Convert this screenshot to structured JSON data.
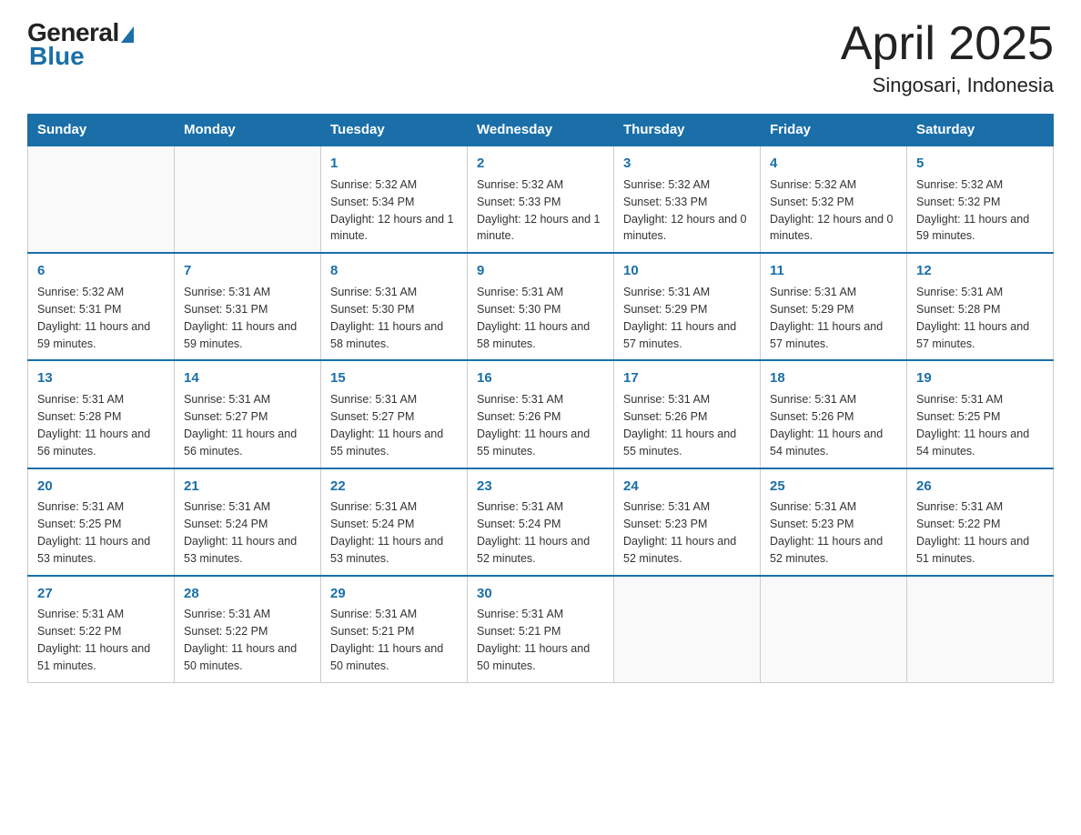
{
  "logo": {
    "general": "General",
    "blue": "Blue"
  },
  "title": "April 2025",
  "subtitle": "Singosari, Indonesia",
  "days_of_week": [
    "Sunday",
    "Monday",
    "Tuesday",
    "Wednesday",
    "Thursday",
    "Friday",
    "Saturday"
  ],
  "weeks": [
    [
      null,
      null,
      {
        "day": "1",
        "sunrise": "Sunrise: 5:32 AM",
        "sunset": "Sunset: 5:34 PM",
        "daylight": "Daylight: 12 hours and 1 minute."
      },
      {
        "day": "2",
        "sunrise": "Sunrise: 5:32 AM",
        "sunset": "Sunset: 5:33 PM",
        "daylight": "Daylight: 12 hours and 1 minute."
      },
      {
        "day": "3",
        "sunrise": "Sunrise: 5:32 AM",
        "sunset": "Sunset: 5:33 PM",
        "daylight": "Daylight: 12 hours and 0 minutes."
      },
      {
        "day": "4",
        "sunrise": "Sunrise: 5:32 AM",
        "sunset": "Sunset: 5:32 PM",
        "daylight": "Daylight: 12 hours and 0 minutes."
      },
      {
        "day": "5",
        "sunrise": "Sunrise: 5:32 AM",
        "sunset": "Sunset: 5:32 PM",
        "daylight": "Daylight: 11 hours and 59 minutes."
      }
    ],
    [
      {
        "day": "6",
        "sunrise": "Sunrise: 5:32 AM",
        "sunset": "Sunset: 5:31 PM",
        "daylight": "Daylight: 11 hours and 59 minutes."
      },
      {
        "day": "7",
        "sunrise": "Sunrise: 5:31 AM",
        "sunset": "Sunset: 5:31 PM",
        "daylight": "Daylight: 11 hours and 59 minutes."
      },
      {
        "day": "8",
        "sunrise": "Sunrise: 5:31 AM",
        "sunset": "Sunset: 5:30 PM",
        "daylight": "Daylight: 11 hours and 58 minutes."
      },
      {
        "day": "9",
        "sunrise": "Sunrise: 5:31 AM",
        "sunset": "Sunset: 5:30 PM",
        "daylight": "Daylight: 11 hours and 58 minutes."
      },
      {
        "day": "10",
        "sunrise": "Sunrise: 5:31 AM",
        "sunset": "Sunset: 5:29 PM",
        "daylight": "Daylight: 11 hours and 57 minutes."
      },
      {
        "day": "11",
        "sunrise": "Sunrise: 5:31 AM",
        "sunset": "Sunset: 5:29 PM",
        "daylight": "Daylight: 11 hours and 57 minutes."
      },
      {
        "day": "12",
        "sunrise": "Sunrise: 5:31 AM",
        "sunset": "Sunset: 5:28 PM",
        "daylight": "Daylight: 11 hours and 57 minutes."
      }
    ],
    [
      {
        "day": "13",
        "sunrise": "Sunrise: 5:31 AM",
        "sunset": "Sunset: 5:28 PM",
        "daylight": "Daylight: 11 hours and 56 minutes."
      },
      {
        "day": "14",
        "sunrise": "Sunrise: 5:31 AM",
        "sunset": "Sunset: 5:27 PM",
        "daylight": "Daylight: 11 hours and 56 minutes."
      },
      {
        "day": "15",
        "sunrise": "Sunrise: 5:31 AM",
        "sunset": "Sunset: 5:27 PM",
        "daylight": "Daylight: 11 hours and 55 minutes."
      },
      {
        "day": "16",
        "sunrise": "Sunrise: 5:31 AM",
        "sunset": "Sunset: 5:26 PM",
        "daylight": "Daylight: 11 hours and 55 minutes."
      },
      {
        "day": "17",
        "sunrise": "Sunrise: 5:31 AM",
        "sunset": "Sunset: 5:26 PM",
        "daylight": "Daylight: 11 hours and 55 minutes."
      },
      {
        "day": "18",
        "sunrise": "Sunrise: 5:31 AM",
        "sunset": "Sunset: 5:26 PM",
        "daylight": "Daylight: 11 hours and 54 minutes."
      },
      {
        "day": "19",
        "sunrise": "Sunrise: 5:31 AM",
        "sunset": "Sunset: 5:25 PM",
        "daylight": "Daylight: 11 hours and 54 minutes."
      }
    ],
    [
      {
        "day": "20",
        "sunrise": "Sunrise: 5:31 AM",
        "sunset": "Sunset: 5:25 PM",
        "daylight": "Daylight: 11 hours and 53 minutes."
      },
      {
        "day": "21",
        "sunrise": "Sunrise: 5:31 AM",
        "sunset": "Sunset: 5:24 PM",
        "daylight": "Daylight: 11 hours and 53 minutes."
      },
      {
        "day": "22",
        "sunrise": "Sunrise: 5:31 AM",
        "sunset": "Sunset: 5:24 PM",
        "daylight": "Daylight: 11 hours and 53 minutes."
      },
      {
        "day": "23",
        "sunrise": "Sunrise: 5:31 AM",
        "sunset": "Sunset: 5:24 PM",
        "daylight": "Daylight: 11 hours and 52 minutes."
      },
      {
        "day": "24",
        "sunrise": "Sunrise: 5:31 AM",
        "sunset": "Sunset: 5:23 PM",
        "daylight": "Daylight: 11 hours and 52 minutes."
      },
      {
        "day": "25",
        "sunrise": "Sunrise: 5:31 AM",
        "sunset": "Sunset: 5:23 PM",
        "daylight": "Daylight: 11 hours and 52 minutes."
      },
      {
        "day": "26",
        "sunrise": "Sunrise: 5:31 AM",
        "sunset": "Sunset: 5:22 PM",
        "daylight": "Daylight: 11 hours and 51 minutes."
      }
    ],
    [
      {
        "day": "27",
        "sunrise": "Sunrise: 5:31 AM",
        "sunset": "Sunset: 5:22 PM",
        "daylight": "Daylight: 11 hours and 51 minutes."
      },
      {
        "day": "28",
        "sunrise": "Sunrise: 5:31 AM",
        "sunset": "Sunset: 5:22 PM",
        "daylight": "Daylight: 11 hours and 50 minutes."
      },
      {
        "day": "29",
        "sunrise": "Sunrise: 5:31 AM",
        "sunset": "Sunset: 5:21 PM",
        "daylight": "Daylight: 11 hours and 50 minutes."
      },
      {
        "day": "30",
        "sunrise": "Sunrise: 5:31 AM",
        "sunset": "Sunset: 5:21 PM",
        "daylight": "Daylight: 11 hours and 50 minutes."
      },
      null,
      null,
      null
    ]
  ]
}
